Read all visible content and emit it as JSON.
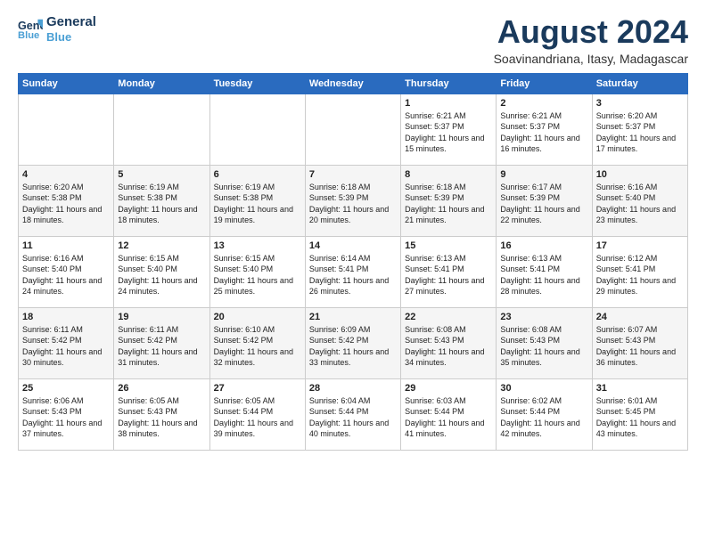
{
  "header": {
    "logo_line1": "General",
    "logo_line2": "Blue",
    "month_year": "August 2024",
    "location": "Soavinandriana, Itasy, Madagascar"
  },
  "days_of_week": [
    "Sunday",
    "Monday",
    "Tuesday",
    "Wednesday",
    "Thursday",
    "Friday",
    "Saturday"
  ],
  "weeks": [
    [
      {
        "day": "",
        "text": ""
      },
      {
        "day": "",
        "text": ""
      },
      {
        "day": "",
        "text": ""
      },
      {
        "day": "",
        "text": ""
      },
      {
        "day": "1",
        "text": "Sunrise: 6:21 AM\nSunset: 5:37 PM\nDaylight: 11 hours and 15 minutes."
      },
      {
        "day": "2",
        "text": "Sunrise: 6:21 AM\nSunset: 5:37 PM\nDaylight: 11 hours and 16 minutes."
      },
      {
        "day": "3",
        "text": "Sunrise: 6:20 AM\nSunset: 5:37 PM\nDaylight: 11 hours and 17 minutes."
      }
    ],
    [
      {
        "day": "4",
        "text": "Sunrise: 6:20 AM\nSunset: 5:38 PM\nDaylight: 11 hours and 18 minutes."
      },
      {
        "day": "5",
        "text": "Sunrise: 6:19 AM\nSunset: 5:38 PM\nDaylight: 11 hours and 18 minutes."
      },
      {
        "day": "6",
        "text": "Sunrise: 6:19 AM\nSunset: 5:38 PM\nDaylight: 11 hours and 19 minutes."
      },
      {
        "day": "7",
        "text": "Sunrise: 6:18 AM\nSunset: 5:39 PM\nDaylight: 11 hours and 20 minutes."
      },
      {
        "day": "8",
        "text": "Sunrise: 6:18 AM\nSunset: 5:39 PM\nDaylight: 11 hours and 21 minutes."
      },
      {
        "day": "9",
        "text": "Sunrise: 6:17 AM\nSunset: 5:39 PM\nDaylight: 11 hours and 22 minutes."
      },
      {
        "day": "10",
        "text": "Sunrise: 6:16 AM\nSunset: 5:40 PM\nDaylight: 11 hours and 23 minutes."
      }
    ],
    [
      {
        "day": "11",
        "text": "Sunrise: 6:16 AM\nSunset: 5:40 PM\nDaylight: 11 hours and 24 minutes."
      },
      {
        "day": "12",
        "text": "Sunrise: 6:15 AM\nSunset: 5:40 PM\nDaylight: 11 hours and 24 minutes."
      },
      {
        "day": "13",
        "text": "Sunrise: 6:15 AM\nSunset: 5:40 PM\nDaylight: 11 hours and 25 minutes."
      },
      {
        "day": "14",
        "text": "Sunrise: 6:14 AM\nSunset: 5:41 PM\nDaylight: 11 hours and 26 minutes."
      },
      {
        "day": "15",
        "text": "Sunrise: 6:13 AM\nSunset: 5:41 PM\nDaylight: 11 hours and 27 minutes."
      },
      {
        "day": "16",
        "text": "Sunrise: 6:13 AM\nSunset: 5:41 PM\nDaylight: 11 hours and 28 minutes."
      },
      {
        "day": "17",
        "text": "Sunrise: 6:12 AM\nSunset: 5:41 PM\nDaylight: 11 hours and 29 minutes."
      }
    ],
    [
      {
        "day": "18",
        "text": "Sunrise: 6:11 AM\nSunset: 5:42 PM\nDaylight: 11 hours and 30 minutes."
      },
      {
        "day": "19",
        "text": "Sunrise: 6:11 AM\nSunset: 5:42 PM\nDaylight: 11 hours and 31 minutes."
      },
      {
        "day": "20",
        "text": "Sunrise: 6:10 AM\nSunset: 5:42 PM\nDaylight: 11 hours and 32 minutes."
      },
      {
        "day": "21",
        "text": "Sunrise: 6:09 AM\nSunset: 5:42 PM\nDaylight: 11 hours and 33 minutes."
      },
      {
        "day": "22",
        "text": "Sunrise: 6:08 AM\nSunset: 5:43 PM\nDaylight: 11 hours and 34 minutes."
      },
      {
        "day": "23",
        "text": "Sunrise: 6:08 AM\nSunset: 5:43 PM\nDaylight: 11 hours and 35 minutes."
      },
      {
        "day": "24",
        "text": "Sunrise: 6:07 AM\nSunset: 5:43 PM\nDaylight: 11 hours and 36 minutes."
      }
    ],
    [
      {
        "day": "25",
        "text": "Sunrise: 6:06 AM\nSunset: 5:43 PM\nDaylight: 11 hours and 37 minutes."
      },
      {
        "day": "26",
        "text": "Sunrise: 6:05 AM\nSunset: 5:43 PM\nDaylight: 11 hours and 38 minutes."
      },
      {
        "day": "27",
        "text": "Sunrise: 6:05 AM\nSunset: 5:44 PM\nDaylight: 11 hours and 39 minutes."
      },
      {
        "day": "28",
        "text": "Sunrise: 6:04 AM\nSunset: 5:44 PM\nDaylight: 11 hours and 40 minutes."
      },
      {
        "day": "29",
        "text": "Sunrise: 6:03 AM\nSunset: 5:44 PM\nDaylight: 11 hours and 41 minutes."
      },
      {
        "day": "30",
        "text": "Sunrise: 6:02 AM\nSunset: 5:44 PM\nDaylight: 11 hours and 42 minutes."
      },
      {
        "day": "31",
        "text": "Sunrise: 6:01 AM\nSunset: 5:45 PM\nDaylight: 11 hours and 43 minutes."
      }
    ]
  ]
}
